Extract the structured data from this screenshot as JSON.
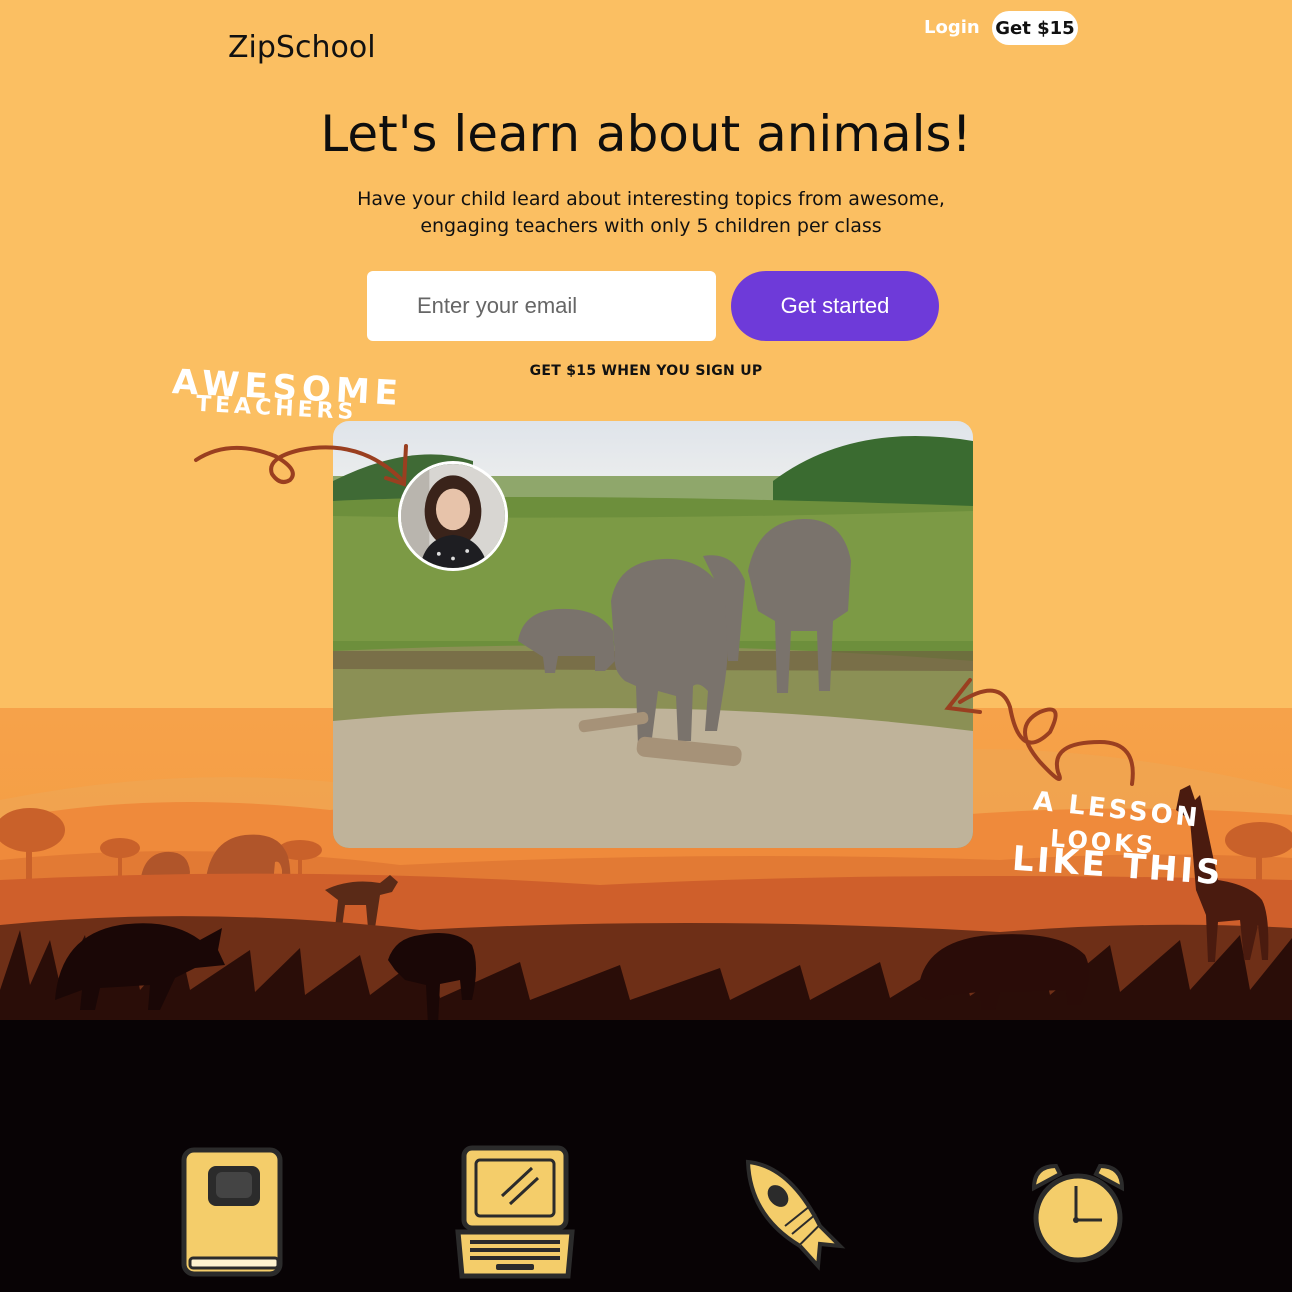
{
  "header": {
    "logo": "ZipSchool",
    "login_label": "Login",
    "cta_label": "Get $15"
  },
  "hero": {
    "headline": "Let's learn about animals!",
    "subtitle": "Have your child leard about interesting topics from awesome, engaging teachers with only 5 children per class",
    "email_placeholder": "Enter your email",
    "start_label": "Get started",
    "promo": "GET $15 WHEN YOU SIGN UP"
  },
  "annotations": {
    "awesome": "AWESOME",
    "teachers": "TEACHERS",
    "a_lesson": "A LESSON",
    "looks": "LOOKS",
    "like_this": "LIKE THIS"
  },
  "features": [
    {
      "icon": "book-icon"
    },
    {
      "icon": "laptop-icon"
    },
    {
      "icon": "rocket-icon"
    },
    {
      "icon": "alarm-clock-icon"
    }
  ],
  "colors": {
    "background": "#fbbf62",
    "accent": "#6e3ad9",
    "arrow": "#9a3f20",
    "icon_fill": "#f4cd6a",
    "footer_dark": "#080305"
  }
}
